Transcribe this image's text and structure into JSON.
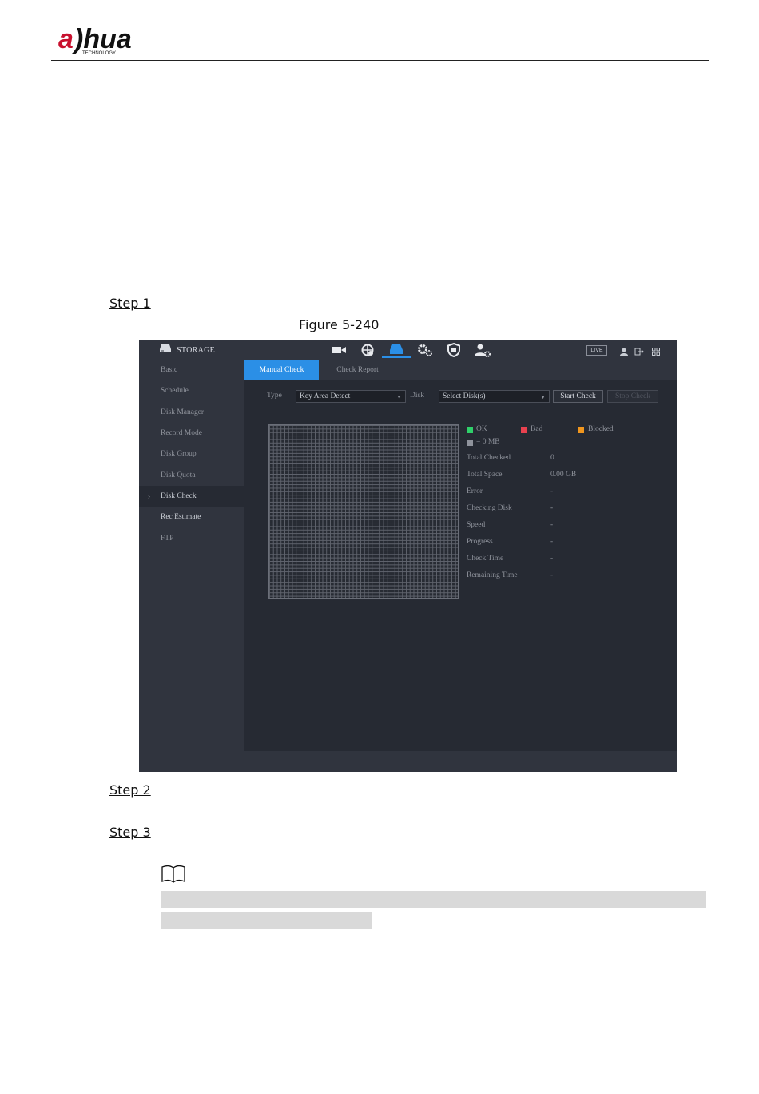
{
  "document": {
    "brand": "alhua",
    "brand_sub": "TECHNOLOGY",
    "step1": "Step 1",
    "figure_caption": "Figure 5-240",
    "step2": "Step 2",
    "step3": "Step 3"
  },
  "ui": {
    "title": "STORAGE",
    "top_icons": [
      "camera-icon",
      "network-icon",
      "storage-icon",
      "system-icon",
      "security-icon",
      "account-icon"
    ],
    "live_badge": "LIVE",
    "sidebar": {
      "items": [
        {
          "label": "Basic"
        },
        {
          "label": "Schedule"
        },
        {
          "label": "Disk Manager"
        },
        {
          "label": "Record Mode"
        },
        {
          "label": "Disk Group"
        },
        {
          "label": "Disk Quota"
        },
        {
          "label": "Disk Check",
          "active": true
        },
        {
          "label": "Rec Estimate"
        },
        {
          "label": "FTP"
        }
      ]
    },
    "tabs": [
      {
        "label": "Manual Check",
        "active": true
      },
      {
        "label": "Check Report",
        "active": false
      }
    ],
    "form": {
      "type_label": "Type",
      "type_value": "Key Area Detect",
      "disk_label": "Disk",
      "disk_value": "Select Disk(s)",
      "start_button": "Start Check",
      "stop_button": "Stop Check"
    },
    "legend": {
      "ok": "OK",
      "bad": "Bad",
      "blocked": "Blocked",
      "unit": "= 0 MB",
      "colors": {
        "ok": "#2fd06a",
        "bad": "#e8414f",
        "blocked": "#f0961e",
        "unit": "#8f939c"
      }
    },
    "info": [
      {
        "label": "Total Checked",
        "value": "0"
      },
      {
        "label": "Total Space",
        "value": "0.00 GB"
      },
      {
        "label": "Error",
        "value": "-"
      },
      {
        "label": "Checking Disk",
        "value": "-"
      },
      {
        "label": "Speed",
        "value": "-"
      },
      {
        "label": "Progress",
        "value": "-"
      },
      {
        "label": "Check Time",
        "value": "-"
      },
      {
        "label": "Remaining Time",
        "value": "-"
      }
    ],
    "accent": "#2b8fe6"
  }
}
